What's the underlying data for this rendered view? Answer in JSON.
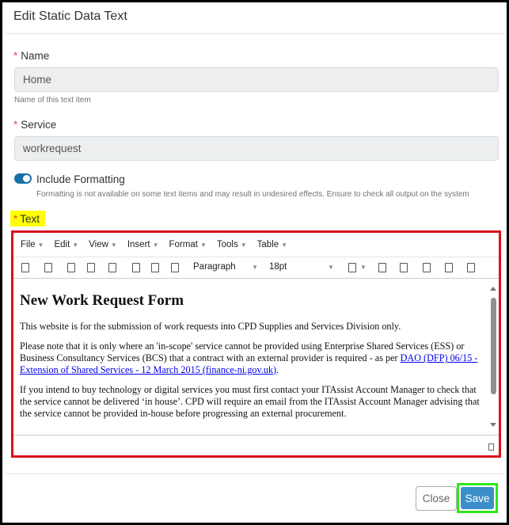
{
  "dialog": {
    "title": "Edit Static Data Text",
    "required_mark": "*"
  },
  "name_field": {
    "label": "Name",
    "value": "Home",
    "help": "Name of this text item"
  },
  "service_field": {
    "label": "Service",
    "value": "workrequest"
  },
  "formatting": {
    "label": "Include Formatting",
    "enabled": true,
    "help": "Formatting is not available on some text items and may result in undesired effects. Ensure to check all output on the system"
  },
  "text_field": {
    "label": "Text"
  },
  "editor": {
    "menus": [
      "File",
      "Edit",
      "View",
      "Insert",
      "Format",
      "Tools",
      "Table"
    ],
    "block_format": "Paragraph",
    "font_size": "18pt",
    "heading": "New Work Request Form",
    "paragraphs": {
      "p1": "This website is for the submission of work requests into CPD Supplies and Services Division only.",
      "p2_pre": "Please note that it is only where an 'in-scope' service cannot be provided using Enterprise Shared Services (ESS) or Business Consultancy Services (BCS) that a contract with an external provider is required - as per ",
      "p2_link": "DAO (DFP) 06/15 - Extension of Shared Services - 12 March 2015 (finance-ni.gov.uk)",
      "p2_post": ".",
      "p3": "If you intend to buy technology or digital services you must first contact your ITAssist Account Manager to check that the service cannot be delivered ‘in house’. CPD will require an email from the ITAssist Account Manager advising that the service cannot be provided in-house before progressing an external procurement."
    }
  },
  "buttons": {
    "close": "Close",
    "save": "Save"
  },
  "colors": {
    "editor_highlight_border": "#d8131b",
    "save_highlight_border": "#2ee61f",
    "label_highlight": "#ffff00",
    "primary": "#3b8ec8",
    "toggle": "#1a6fa8"
  }
}
